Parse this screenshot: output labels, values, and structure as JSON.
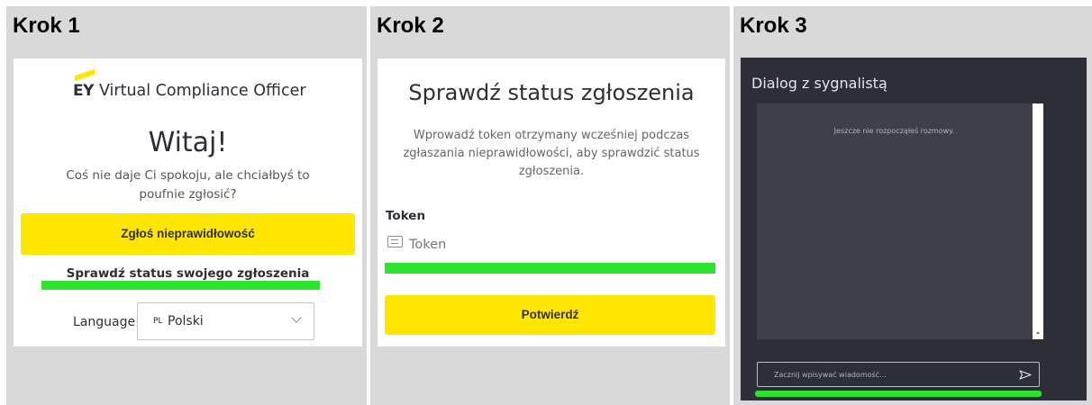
{
  "steps": [
    {
      "label": "Krok 1"
    },
    {
      "label": "Krok 2"
    },
    {
      "label": "Krok 3"
    }
  ],
  "step1": {
    "logo_brand": "EY",
    "logo_text": "Virtual Compliance Officer",
    "welcome": "Witaj!",
    "subtitle": "Coś nie daje Ci spokoju, ale chciałbyś to poufnie zgłosić?",
    "report_button": "Zgłoś nieprawidłowość",
    "check_status_link": "Sprawdź status swojego zgłoszenia",
    "language_label": "Language",
    "language_code": "PL",
    "language_value": "Polski"
  },
  "step2": {
    "title": "Sprawdź status zgłoszenia",
    "description": "Wprowadź token otrzymany wcześniej podczas zgłaszania nieprawidłowości, aby sprawdzić status zgłoszenia.",
    "token_label": "Token",
    "token_placeholder": "Token",
    "confirm_button": "Potwierdź"
  },
  "step3": {
    "title": "Dialog z sygnalistą",
    "empty_message": "Jeszcze nie rozpocząłeś rozmowy.",
    "input_placeholder": "Zacznij wpisywać wiadomość..."
  },
  "colors": {
    "yellow": "#ffe600",
    "highlight_green": "#2ee32e",
    "dark_bg": "#2e2e38",
    "panel_gray": "#d9d9d9"
  },
  "icons": {
    "token": "ticket-icon",
    "send": "send-icon",
    "select": "chevron-down-icon"
  }
}
